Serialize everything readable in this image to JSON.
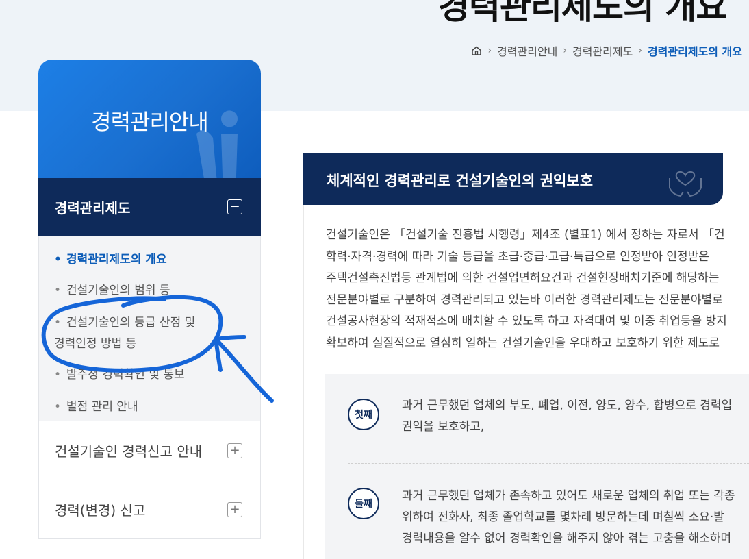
{
  "page_title": "경력관리제도의 개요",
  "breadcrumb": {
    "items": [
      "경력관리안내",
      "경력관리제도"
    ],
    "current": "경력관리제도의 개요"
  },
  "sidebar": {
    "title": "경력관리안내",
    "active_menu": {
      "label": "경력관리제도",
      "toggle": "−"
    },
    "subitems": [
      {
        "label": "경력관리제도의 개요"
      },
      {
        "label": "건설기술인의 범위 등"
      },
      {
        "label": "건설기술인의 등급 산정 및"
      },
      {
        "label": "경력인정 방법 등"
      },
      {
        "label": "발주청 경력확인 및 통보"
      },
      {
        "label": "벌점 관리 안내"
      }
    ],
    "menus": [
      {
        "label": "건설기술인 경력신고 안내",
        "toggle": "+"
      },
      {
        "label": "경력(변경) 신고",
        "toggle": "+"
      }
    ]
  },
  "section": {
    "title": "체계적인 경력관리로 건설기술인의 권익보호",
    "paragraph": [
      "건설기술인은 「건설기술 진흥법 시행령」제4조 (별표1) 에서 정하는 자로서 「건",
      "학력·자격·경력에 따라 기술 등급을 초급·중급·고급·특급으로 인정받아 인정받은",
      "주택건설촉진법등 관계법에 의한 건설업면허요건과 건설현장배치기준에 해당하는",
      "전문분야별로 구분하여 경력관리되고 있는바 이러한 경력관리제도는 전문분야별로",
      "건설공사현장의 적재적소에 배치할 수 있도록 하고 자격대여 및 이중 취업등을 방지",
      "확보하여 실질적으로 열심히 일하는 건설기술인을 우대하고 보호하기 위한 제도로"
    ]
  },
  "points": [
    {
      "badge": "첫째",
      "lines": [
        "과거 근무했던 업체의 부도, 폐업, 이전, 양도, 양수, 합병으로 경력입",
        "권익을 보호하고,"
      ]
    },
    {
      "badge": "둘째",
      "lines": [
        "과거 근무했던 업체가 존속하고 있어도 새로운 업체의 취업 또는 각종",
        "위하여 전화사, 최종 졸업학교를 몇차례 방문하는데 며칠씩 소요·발",
        "경력내용을 알수 없어 경력확인을 해주지 않아 겪는 고충을 해소하며"
      ]
    }
  ],
  "colors": {
    "navy": "#0e2a5a",
    "blue": "#1a6fd0",
    "link": "#0d5db8",
    "annotation": "#1565d8"
  }
}
